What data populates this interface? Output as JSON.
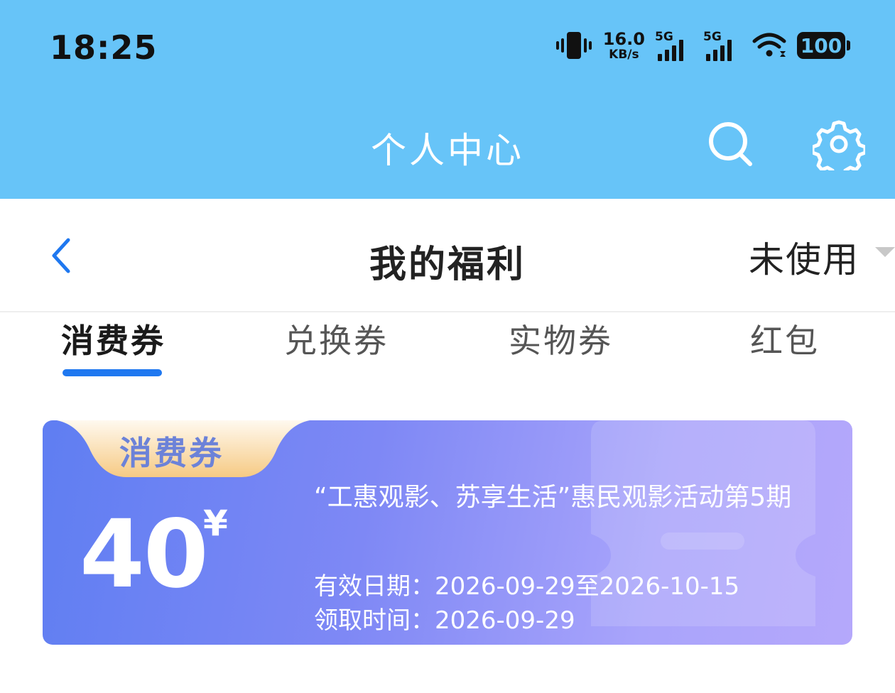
{
  "status_bar": {
    "time": "18:25",
    "net_speed_value": "16.0",
    "net_speed_unit": "KB/s",
    "sim1": "5G",
    "sim2": "5G",
    "battery": "100"
  },
  "app_header": {
    "title": "个人中心",
    "icons": [
      "search-icon",
      "gear-icon"
    ],
    "background_color": "#67c4f8"
  },
  "page_header": {
    "title": "我的福利",
    "filter_value": "未使用"
  },
  "tabs": [
    {
      "label": "消费券",
      "active": true
    },
    {
      "label": "兑换券",
      "active": false
    },
    {
      "label": "实物券",
      "active": false
    },
    {
      "label": "红包",
      "active": false
    }
  ],
  "accent_color": "#1f78f0",
  "coupon": {
    "badge": "消费券",
    "amount": "40",
    "currency": "¥",
    "title": "“工惠观影、苏享生活”惠民观影活动第5期",
    "validity": "有效日期：2026-09-29至2026-10-15",
    "received": "领取时间：2026-09-29"
  }
}
